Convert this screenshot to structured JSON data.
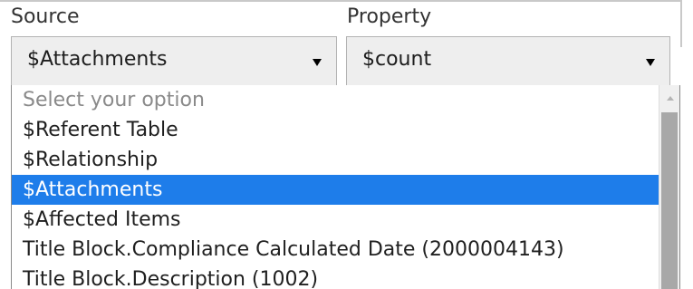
{
  "form": {
    "source_label": "Source",
    "property_label": "Property"
  },
  "source_select": {
    "value": "$Attachments",
    "arrow_icon": "triangle-down-icon"
  },
  "property_select": {
    "value": "$count",
    "arrow_icon": "triangle-down-icon"
  },
  "source_dropdown": {
    "options": [
      "Select your option",
      "$Referent Table",
      "$Relationship",
      "$Attachments",
      "$Affected Items",
      "Title Block.Compliance Calculated Date (2000004143)",
      "Title Block.Description (1002)"
    ],
    "selected_option": "$Attachments",
    "placeholder_option": "Select your option",
    "scroll_up_icon": "scroll-up-arrow-icon"
  },
  "colors": {
    "highlight": "#1e7dea",
    "select_background": "#eeeeee",
    "placeholder_text": "#8a8a8a",
    "scrollbar_thumb": "#a8a8a8"
  }
}
